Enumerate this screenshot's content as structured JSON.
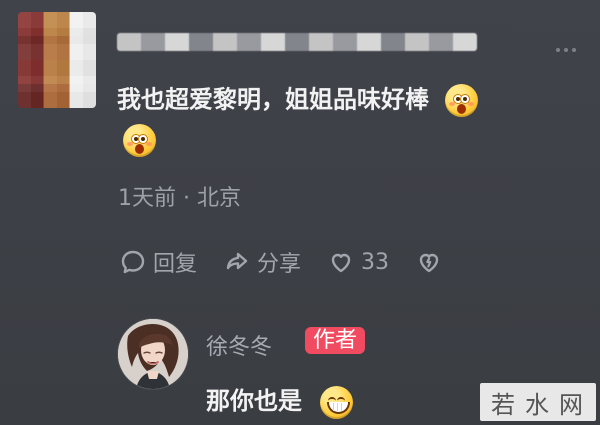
{
  "comment": {
    "text": "我也超爱黎明，姐姐品味好棒",
    "meta": "1天前 · 北京"
  },
  "actions": {
    "reply_label": "回复",
    "share_label": "分享",
    "like_count": "33"
  },
  "reply": {
    "author_name": "徐冬冬",
    "author_badge": "作者",
    "text": "那你也是"
  },
  "watermark": "若水网",
  "colors": {
    "background": "#3a3d42",
    "text_primary": "#f2f2f2",
    "text_secondary": "#9ea1a8",
    "badge": "#f14b61"
  },
  "icons": {
    "more": "more-dots-icon",
    "reply": "comment-bubble-icon",
    "share": "share-arrow-icon",
    "like": "heart-icon",
    "dislike": "broken-heart-icon",
    "comment_emoji": "shocked-emoji-icon",
    "reply_emoji": "grin-emoji-icon"
  }
}
